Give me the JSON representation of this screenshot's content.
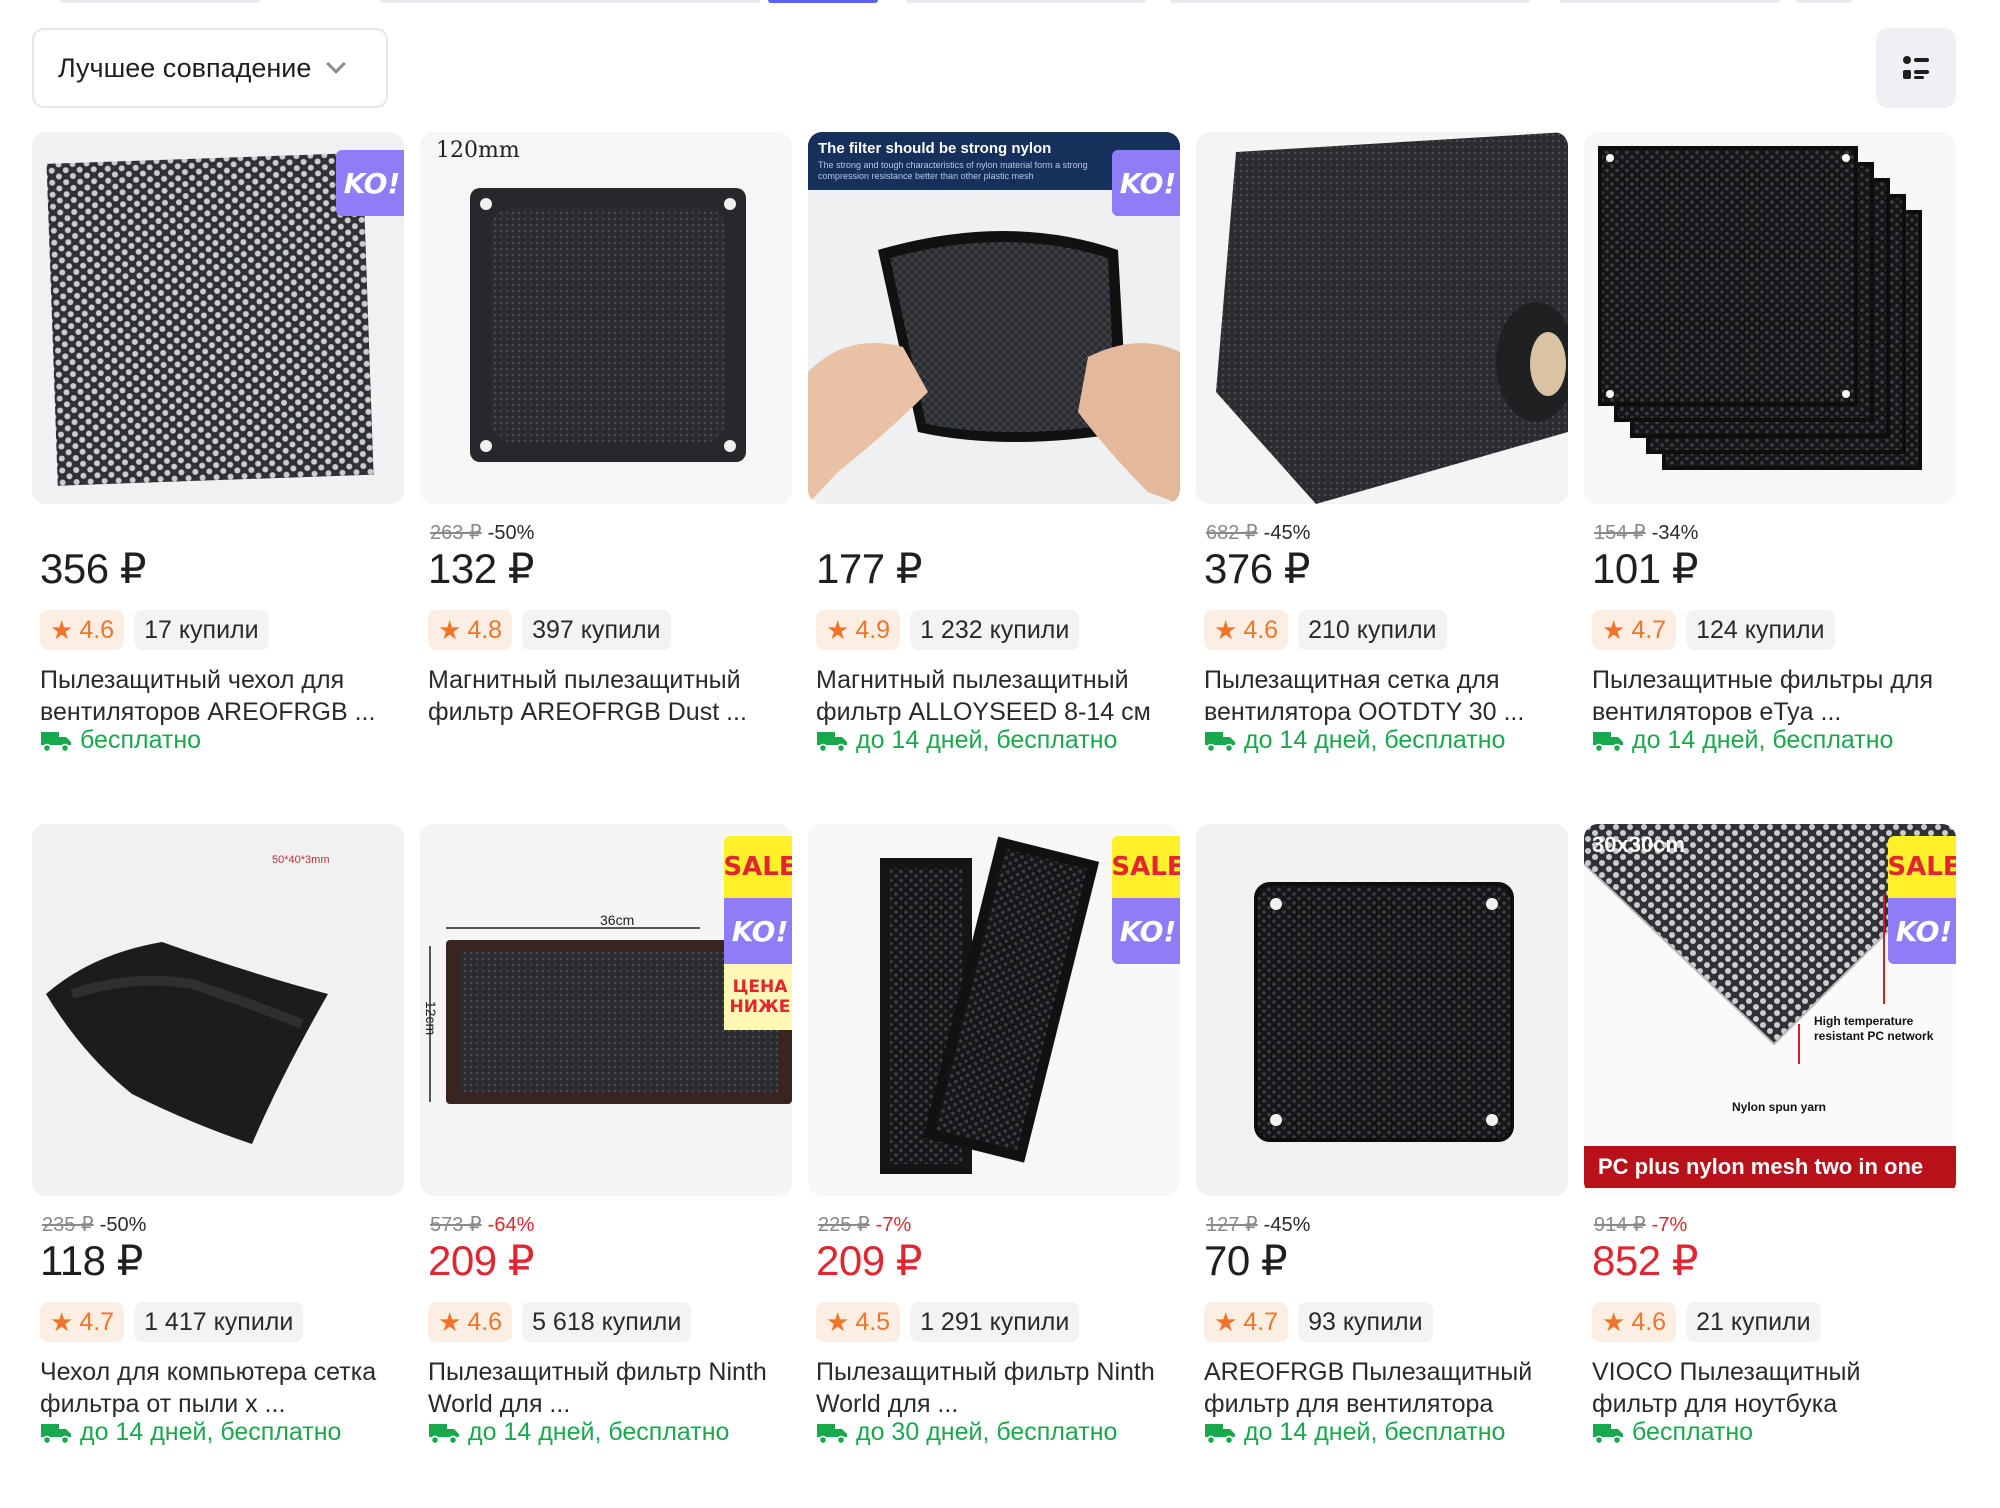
{
  "toolbar": {
    "sort_label": "Лучшее совпадение"
  },
  "colors": {
    "accent_red": "#e0262f",
    "rating_orange": "#f0752a",
    "delivery_green": "#18a94c",
    "ko_badge": "#8f7cf7",
    "sale_badge": "#fff02a"
  },
  "products": [
    {
      "image": "perforated-mesh-sheet",
      "badges": [
        "KO!"
      ],
      "old_price": "",
      "discount": "",
      "price": "356 ₽",
      "price_red": false,
      "rating": "4.6",
      "bought": "17 купили",
      "title": "Пылезащитный чехол для вентиляторов AREOFRGB ...",
      "delivery": "бесплатно"
    },
    {
      "image": "magnetic-square-filter",
      "image_text": "120mm",
      "badges": [],
      "old_price": "263 ₽",
      "discount": "-50%",
      "price": "132 ₽",
      "price_red": false,
      "rating": "4.8",
      "bought": "397 купили",
      "title": "Магнитный пылезащитный фильтр AREOFRGB Dust ...",
      "delivery": ""
    },
    {
      "image": "nylon-filter-in-hands",
      "image_text": "The filter should be strong nylon",
      "image_subtext": "The strong and tough characteristics of nylon material form a strong compression resistance better than other plastic mesh",
      "badges": [
        "KO!"
      ],
      "old_price": "",
      "discount": "",
      "price": "177 ₽",
      "price_red": false,
      "rating": "4.9",
      "bought": "1 232 купили",
      "title": "Магнитный пылезащитный фильтр ALLOYSEED 8-14 см",
      "delivery": "до 14 дней, бесплатно"
    },
    {
      "image": "mesh-roll",
      "badges": [],
      "old_price": "682 ₽",
      "discount": "-45%",
      "price": "376 ₽",
      "price_red": false,
      "rating": "4.6",
      "bought": "210 купили",
      "title": "Пылезащитная сетка для вентилятора OOTDTY 30 ...",
      "delivery": "до 14 дней, бесплатно"
    },
    {
      "image": "stacked-filters",
      "badges": [],
      "old_price": "154 ₽",
      "discount": "-34%",
      "price": "101 ₽",
      "price_red": false,
      "rating": "4.7",
      "bought": "124 купили",
      "title": "Пылезащитные фильтры для вентиляторов eTya ...",
      "delivery": "до 14 дней, бесплатно"
    },
    {
      "image": "fabric-sheet",
      "image_text": "50*40*3mm",
      "badges": [],
      "old_price": "235 ₽",
      "discount": "-50%",
      "price": "118 ₽",
      "price_red": false,
      "rating": "4.7",
      "bought": "1 417 купили",
      "title": "Чехол для компьютера сетка фильтра от пыли x ...",
      "delivery": "до 14 дней, бесплатно"
    },
    {
      "image": "rectangular-filter",
      "image_text": "36cm",
      "image_text2": "12cm",
      "badges": [
        "SALE",
        "KO!",
        "ЦЕНА НИЖЕ"
      ],
      "old_price": "573 ₽",
      "discount": "-64%",
      "price": "209 ₽",
      "price_red": true,
      "rating": "4.6",
      "bought": "5 618 купили",
      "title": "Пылезащитный фильтр Ninth World для ...",
      "delivery": "до 14 дней, бесплатно"
    },
    {
      "image": "two-mesh-panels",
      "badges": [
        "SALE",
        "KO!"
      ],
      "old_price": "225 ₽",
      "discount": "-7%",
      "price": "209 ₽",
      "price_red": true,
      "rating": "4.5",
      "bought": "1 291 купили",
      "title": "Пылезащитный фильтр Ninth World для ...",
      "delivery": "до 30 дней, бесплатно"
    },
    {
      "image": "square-hex-filter",
      "badges": [],
      "old_price": "127 ₽",
      "discount": "-45%",
      "price": "70 ₽",
      "price_red": false,
      "rating": "4.7",
      "bought": "93 купили",
      "title": "AREOFRGB Пылезащитный фильтр для вентилятора",
      "delivery": "до 14 дней, бесплатно"
    },
    {
      "image": "pc-nylon-mesh",
      "image_text": "30x30cm",
      "image_text2": "High temperature resistant PC network",
      "image_text3": "Nylon spun yarn",
      "image_text4": "PC plus nylon mesh two in one",
      "badges": [
        "SALE",
        "KO!"
      ],
      "old_price": "914 ₽",
      "discount": "-7%",
      "price": "852 ₽",
      "price_red": true,
      "rating": "4.6",
      "bought": "21 купили",
      "title": "VIOCO Пылезащитный фильтр для ноутбука",
      "delivery": "бесплатно"
    }
  ]
}
